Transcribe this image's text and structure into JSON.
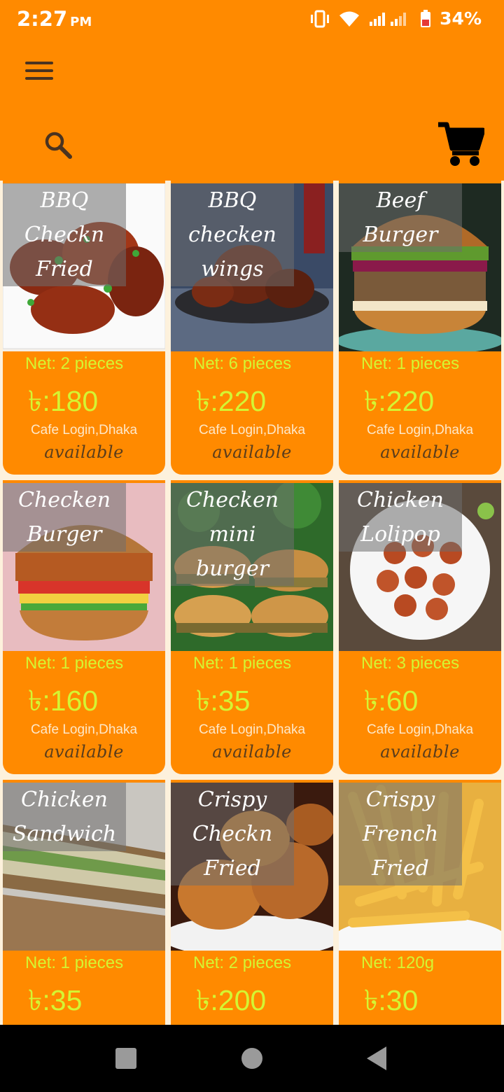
{
  "status_bar": {
    "time": "2:27",
    "ampm": "PM",
    "battery": "34%"
  },
  "app_bar": {
    "menu_icon": "hamburger-menu-icon",
    "search_icon": "search-icon",
    "cart_icon": "shopping-cart-icon"
  },
  "colors": {
    "primary": "#ff8a00",
    "accent_text": "#d4f532",
    "background": "#fdf1dc"
  },
  "products": [
    {
      "name": "BBQ Checkn Fried",
      "net": "Net: 2 pieces",
      "price": "৳:180",
      "location": "Cafe Login,Dhaka",
      "status": "available"
    },
    {
      "name": "BBQ checken wings",
      "net": "Net: 6 pieces",
      "price": "৳:220",
      "location": "Cafe Login,Dhaka",
      "status": "available"
    },
    {
      "name": "Beef Burger",
      "net": "Net: 1 pieces",
      "price": "৳:220",
      "location": "Cafe Login,Dhaka",
      "status": "available"
    },
    {
      "name": "Checken Burger",
      "net": "Net: 1 pieces",
      "price": "৳:160",
      "location": "Cafe Login,Dhaka",
      "status": "available"
    },
    {
      "name": "Checken mini burger",
      "net": "Net: 1 pieces",
      "price": "৳:35",
      "location": "Cafe Login,Dhaka",
      "status": "available"
    },
    {
      "name": "Chicken Lolipop",
      "net": "Net: 3 pieces",
      "price": "৳:60",
      "location": "Cafe Login,Dhaka",
      "status": "available"
    },
    {
      "name": "Chicken Sandwich",
      "net": "Net: 1 pieces",
      "price": "৳:35",
      "location": "",
      "status": ""
    },
    {
      "name": "Crispy Checkn Fried",
      "net": "Net: 2 pieces",
      "price": "৳:200",
      "location": "",
      "status": ""
    },
    {
      "name": "Crispy French Fried",
      "net": "Net: 120g",
      "price": "৳:30",
      "location": "",
      "status": ""
    }
  ],
  "nav_bar": {
    "recents_icon": "recents-square-icon",
    "home_icon": "home-circle-icon",
    "back_icon": "back-triangle-icon"
  }
}
